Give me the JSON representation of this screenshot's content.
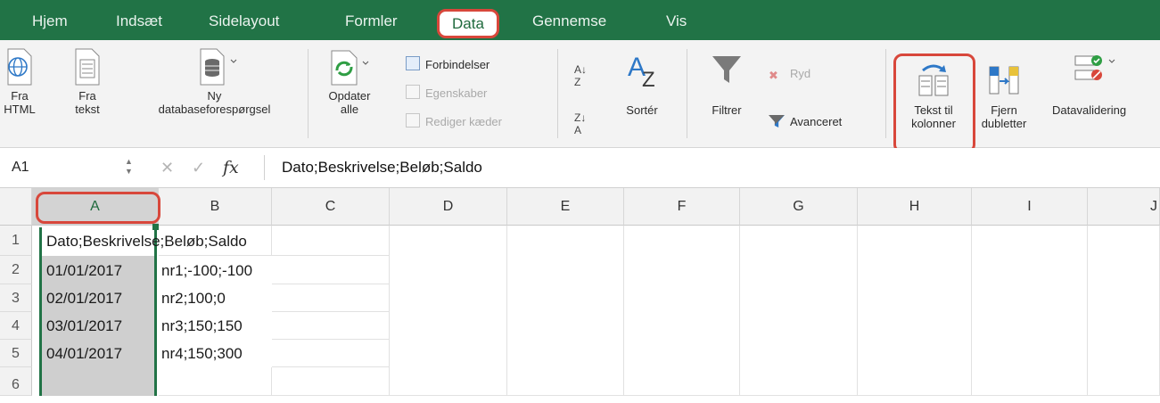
{
  "ribbon_tabs": [
    "Hjem",
    "Indsæt",
    "Sidelayout",
    "Formler",
    "Data",
    "Gennemse",
    "Vis"
  ],
  "active_tab": "Data",
  "ribbon": {
    "fra_html": [
      "Fra",
      "HTML"
    ],
    "fra_tekst": [
      "Fra",
      "tekst"
    ],
    "ny_database": [
      "Ny",
      "databaseforespørgsel"
    ],
    "opdater_alle": [
      "Opdater",
      "alle"
    ],
    "forbindelser": "Forbindelser",
    "egenskaber": "Egenskaber",
    "rediger_kaeder": "Rediger kæder",
    "sorter": "Sortér",
    "filtrer": "Filtrer",
    "ryd": "Ryd",
    "avanceret": "Avanceret",
    "tekst_til_kolonner": [
      "Tekst til",
      "kolonner"
    ],
    "fjern_dubletter": [
      "Fjern",
      "dubletter"
    ],
    "datavalidering": "Datavalidering"
  },
  "formula_bar": {
    "name_box": "A1",
    "fx": "fx",
    "formula": "Dato;Beskrivelse;Beløb;Saldo"
  },
  "columns": [
    "A",
    "B",
    "C",
    "D",
    "E",
    "F",
    "G",
    "H",
    "I",
    "J"
  ],
  "selected_column": "A",
  "rows": [
    "1",
    "2",
    "3",
    "4",
    "5",
    "6"
  ],
  "cells": {
    "r1": "Dato;Beskrivelse;Beløb;Saldo",
    "r2a": "01/01/2017",
    "r2b": "nr1;-100;-100",
    "r3a": "02/01/2017",
    "r3b": "nr2;100;0",
    "r4a": "03/01/2017",
    "r4b": "nr3;150;150",
    "r5a": "04/01/2017",
    "r5b": "nr4;150;300"
  },
  "colors": {
    "ribbon_green": "#217346",
    "highlight_red": "#d8473b",
    "selection_green": "#217346"
  }
}
